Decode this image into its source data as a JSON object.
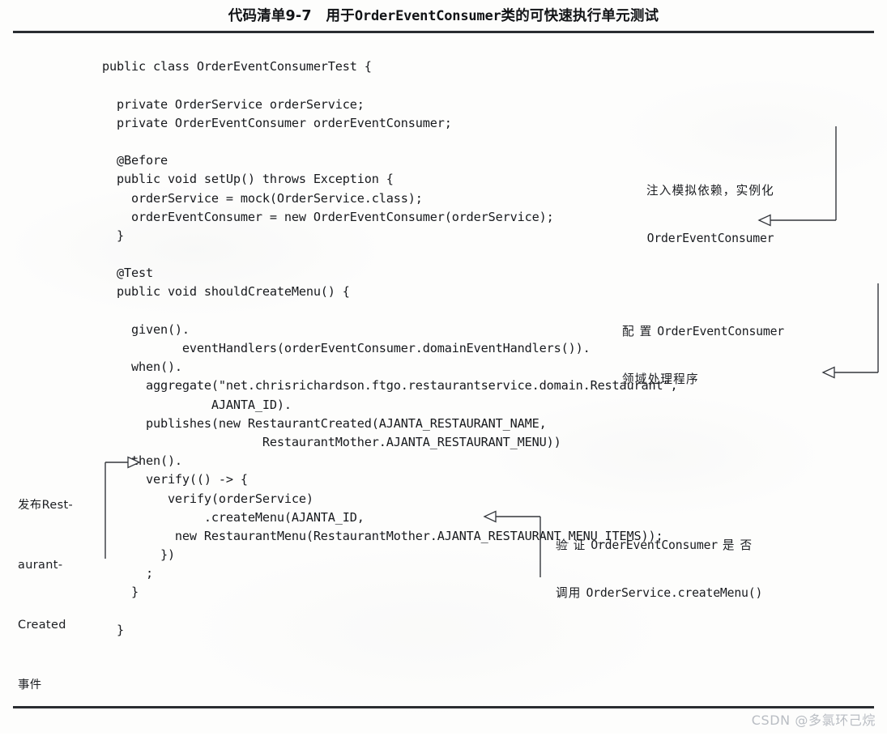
{
  "caption": {
    "prefix": "代码清单9-7",
    "spacer": "　",
    "mid": "用于",
    "mono": "OrderEventConsumer",
    "suffix": "类的可快速执行单元测试"
  },
  "code": {
    "lines": [
      "public class OrderEventConsumerTest {",
      "",
      "  private OrderService orderService;",
      "  private OrderEventConsumer orderEventConsumer;",
      "",
      "  @Before",
      "  public void setUp() throws Exception {",
      "    orderService = mock(OrderService.class);",
      "    orderEventConsumer = new OrderEventConsumer(orderService);",
      "  }",
      "",
      "  @Test",
      "  public void shouldCreateMenu() {",
      "",
      "    given().",
      "           eventHandlers(orderEventConsumer.domainEventHandlers()).",
      "    when().",
      "      aggregate(\"net.chrisrichardson.ftgo.restaurantservice.domain.Restaurant\",",
      "               AJANTA_ID).",
      "      publishes(new RestaurantCreated(AJANTA_RESTAURANT_NAME,",
      "                      RestaurantMother.AJANTA_RESTAURANT_MENU))",
      "    then().",
      "      verify(() -> {",
      "         verify(orderService)",
      "              .createMenu(AJANTA_ID,",
      "          new RestaurantMenu(RestaurantMother.AJANTA_RESTAURANT_MENU_ITEMS));",
      "        })",
      "      ;",
      "    }",
      "",
      "  }"
    ]
  },
  "annotations": [
    {
      "id": "inject-mocks",
      "line1_cn": "注入模拟依赖，实例化",
      "line2_mono": "OrderEventConsumer"
    },
    {
      "id": "configure-handlers",
      "line1_cn": "配 置 ",
      "line1_mono": "OrderEventConsumer",
      "line2_cn": "领域处理程序"
    },
    {
      "id": "publish-event",
      "lines": [
        "发布Rest-",
        "aurant-",
        "Created",
        "事件"
      ]
    },
    {
      "id": "verify-createmenu",
      "line1_cn_a": "验 证 ",
      "line1_mono": "OrderEventConsumer",
      "line1_cn_b": " 是 否",
      "line2_cn": "调用 ",
      "line2_mono": "OrderService.createMenu()"
    }
  ],
  "watermark": {
    "text": "CSDN @多氯环己烷"
  },
  "colors": {
    "ink": "#17191d",
    "rule": "#2a2d31",
    "watermark": "#b9bdc3",
    "paper": "#fdfdfc"
  }
}
